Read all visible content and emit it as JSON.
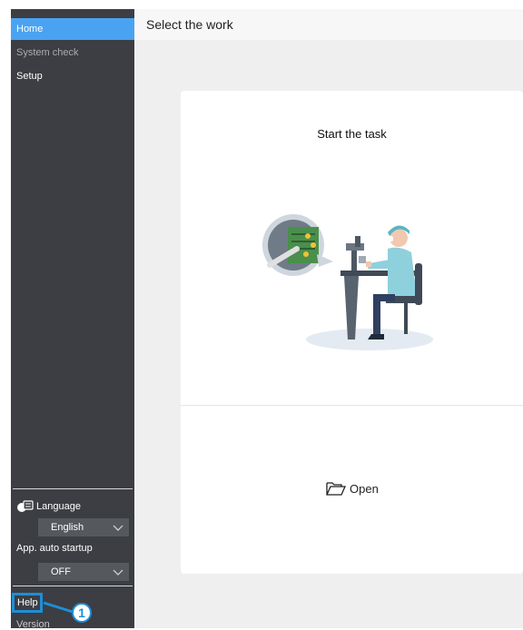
{
  "sidebar": {
    "items": [
      {
        "label": "Home"
      },
      {
        "label": "System check"
      },
      {
        "label": "Setup"
      }
    ],
    "language_label": "Language",
    "language_value": "English",
    "auto_startup_label": "App. auto startup",
    "auto_startup_value": "OFF",
    "help_label": "Help",
    "version_label": "Version"
  },
  "header": {
    "title": "Select the work"
  },
  "card": {
    "title": "Start the task",
    "open_label": "Open"
  },
  "callout": {
    "number": "1"
  },
  "colors": {
    "accent": "#4aa3f2",
    "sidebar": "#3c3e43",
    "callout": "#1e8ed8"
  }
}
